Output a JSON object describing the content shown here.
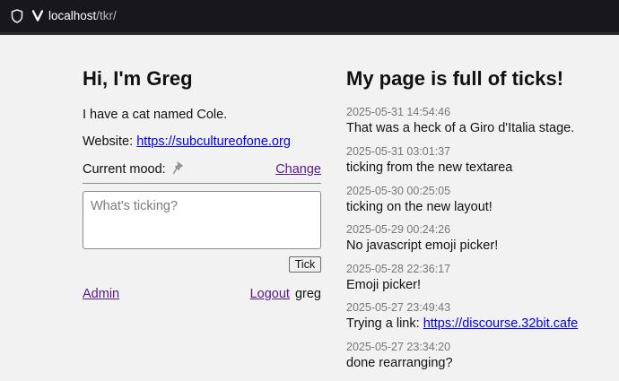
{
  "browser": {
    "url_host": "localhost",
    "url_path": "/tkr/"
  },
  "profile": {
    "greeting": "Hi, I'm Greg",
    "description": "I have a cat named Cole.",
    "website_label": "Website:",
    "website_url": "https://subcultureofone.org",
    "mood_label": "Current mood:",
    "mood_emoji": "pushpin",
    "change_label": "Change"
  },
  "composer": {
    "placeholder": "What's ticking?",
    "value": "",
    "button_label": "Tick"
  },
  "footer": {
    "admin_label": "Admin",
    "logout_label": "Logout",
    "username": "greg"
  },
  "feed": {
    "title": "My page is full of ticks!",
    "ticks": [
      {
        "timestamp": "2025-05-31 14:54:46",
        "text": "That was a heck of a Giro d'Italia stage."
      },
      {
        "timestamp": "2025-05-31 03:01:37",
        "text": "ticking from the new textarea"
      },
      {
        "timestamp": "2025-05-30 00:25:05",
        "text": "ticking on the new layout!"
      },
      {
        "timestamp": "2025-05-29 00:24:26",
        "text": "No javascript emoji picker!"
      },
      {
        "timestamp": "2025-05-28 22:36:17",
        "text": "Emoji picker!"
      },
      {
        "timestamp": "2025-05-27 23:49:43",
        "text": "Trying a link: ",
        "link": "https://discourse.32bit.cafe"
      },
      {
        "timestamp": "2025-05-27 23:34:20",
        "text": "done rearranging?"
      }
    ]
  },
  "colors": {
    "link": "#0000ee",
    "visited_link": "#551a8b",
    "background": "#f2f2f2",
    "timestamp": "#777777"
  }
}
